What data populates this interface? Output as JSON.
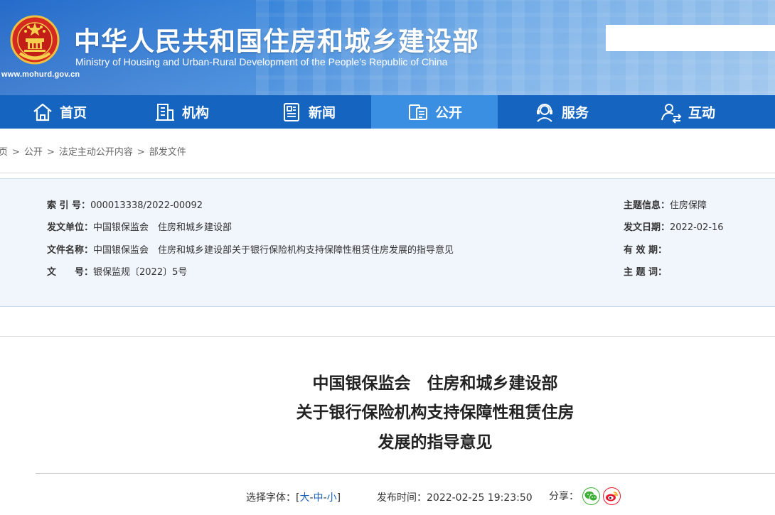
{
  "header": {
    "title": "中华人民共和国住房和城乡建设部",
    "subtitle": "Ministry of Housing and Urban-Rural Development of the People’s Republic of China",
    "url": "www.mohurd.gov.cn",
    "search_value": ""
  },
  "nav": {
    "items": [
      {
        "label": "首页",
        "icon": "home-icon"
      },
      {
        "label": "机构",
        "icon": "building-icon"
      },
      {
        "label": "新闻",
        "icon": "news-icon"
      },
      {
        "label": "公开",
        "icon": "disclosure-icon",
        "active": true
      },
      {
        "label": "服务",
        "icon": "service-icon"
      },
      {
        "label": "互动",
        "icon": "interaction-icon"
      }
    ],
    "colors": {
      "bar": "#1565c0",
      "active": "#3b8fe2"
    }
  },
  "breadcrumb": {
    "items": [
      "页",
      "公开",
      "法定主动公开内容",
      "部发文件"
    ],
    "separator": ">"
  },
  "info": {
    "index_label": "索 引 号：",
    "index_value": "000013338/2022-00092",
    "issuer_label": "发文单位：",
    "issuer_value": "中国银保监会　住房和城乡建设部",
    "docname_label": "文件名称：",
    "docname_value": "中国银保监会　住房和城乡建设部关于银行保险机构支持保障性租赁住房发展的指导意见",
    "docno_label": "文　　号：",
    "docno_value": "银保监规〔2022〕5号",
    "topic_label": "主题信息：",
    "topic_value": "住房保障",
    "date_label": "发文日期：",
    "date_value": "2022-02-16",
    "validity_label": "有 效 期：",
    "validity_value": "",
    "keywords_label": "主 题 词：",
    "keywords_value": ""
  },
  "article": {
    "title_line1": "中国银保监会　住房和城乡建设部",
    "title_line2": "关于银行保险机构支持保障性租赁住房",
    "title_line3": "发展的指导意见"
  },
  "meta": {
    "font_label": "选择字体：",
    "bracket_open": "[",
    "font_large": "大",
    "font_medium": "中",
    "font_small": "小",
    "dash": "-",
    "bracket_close": "]",
    "publish_label": "发布时间：",
    "publish_value": "2022-02-25 19:23:50",
    "share_label": "分享："
  }
}
